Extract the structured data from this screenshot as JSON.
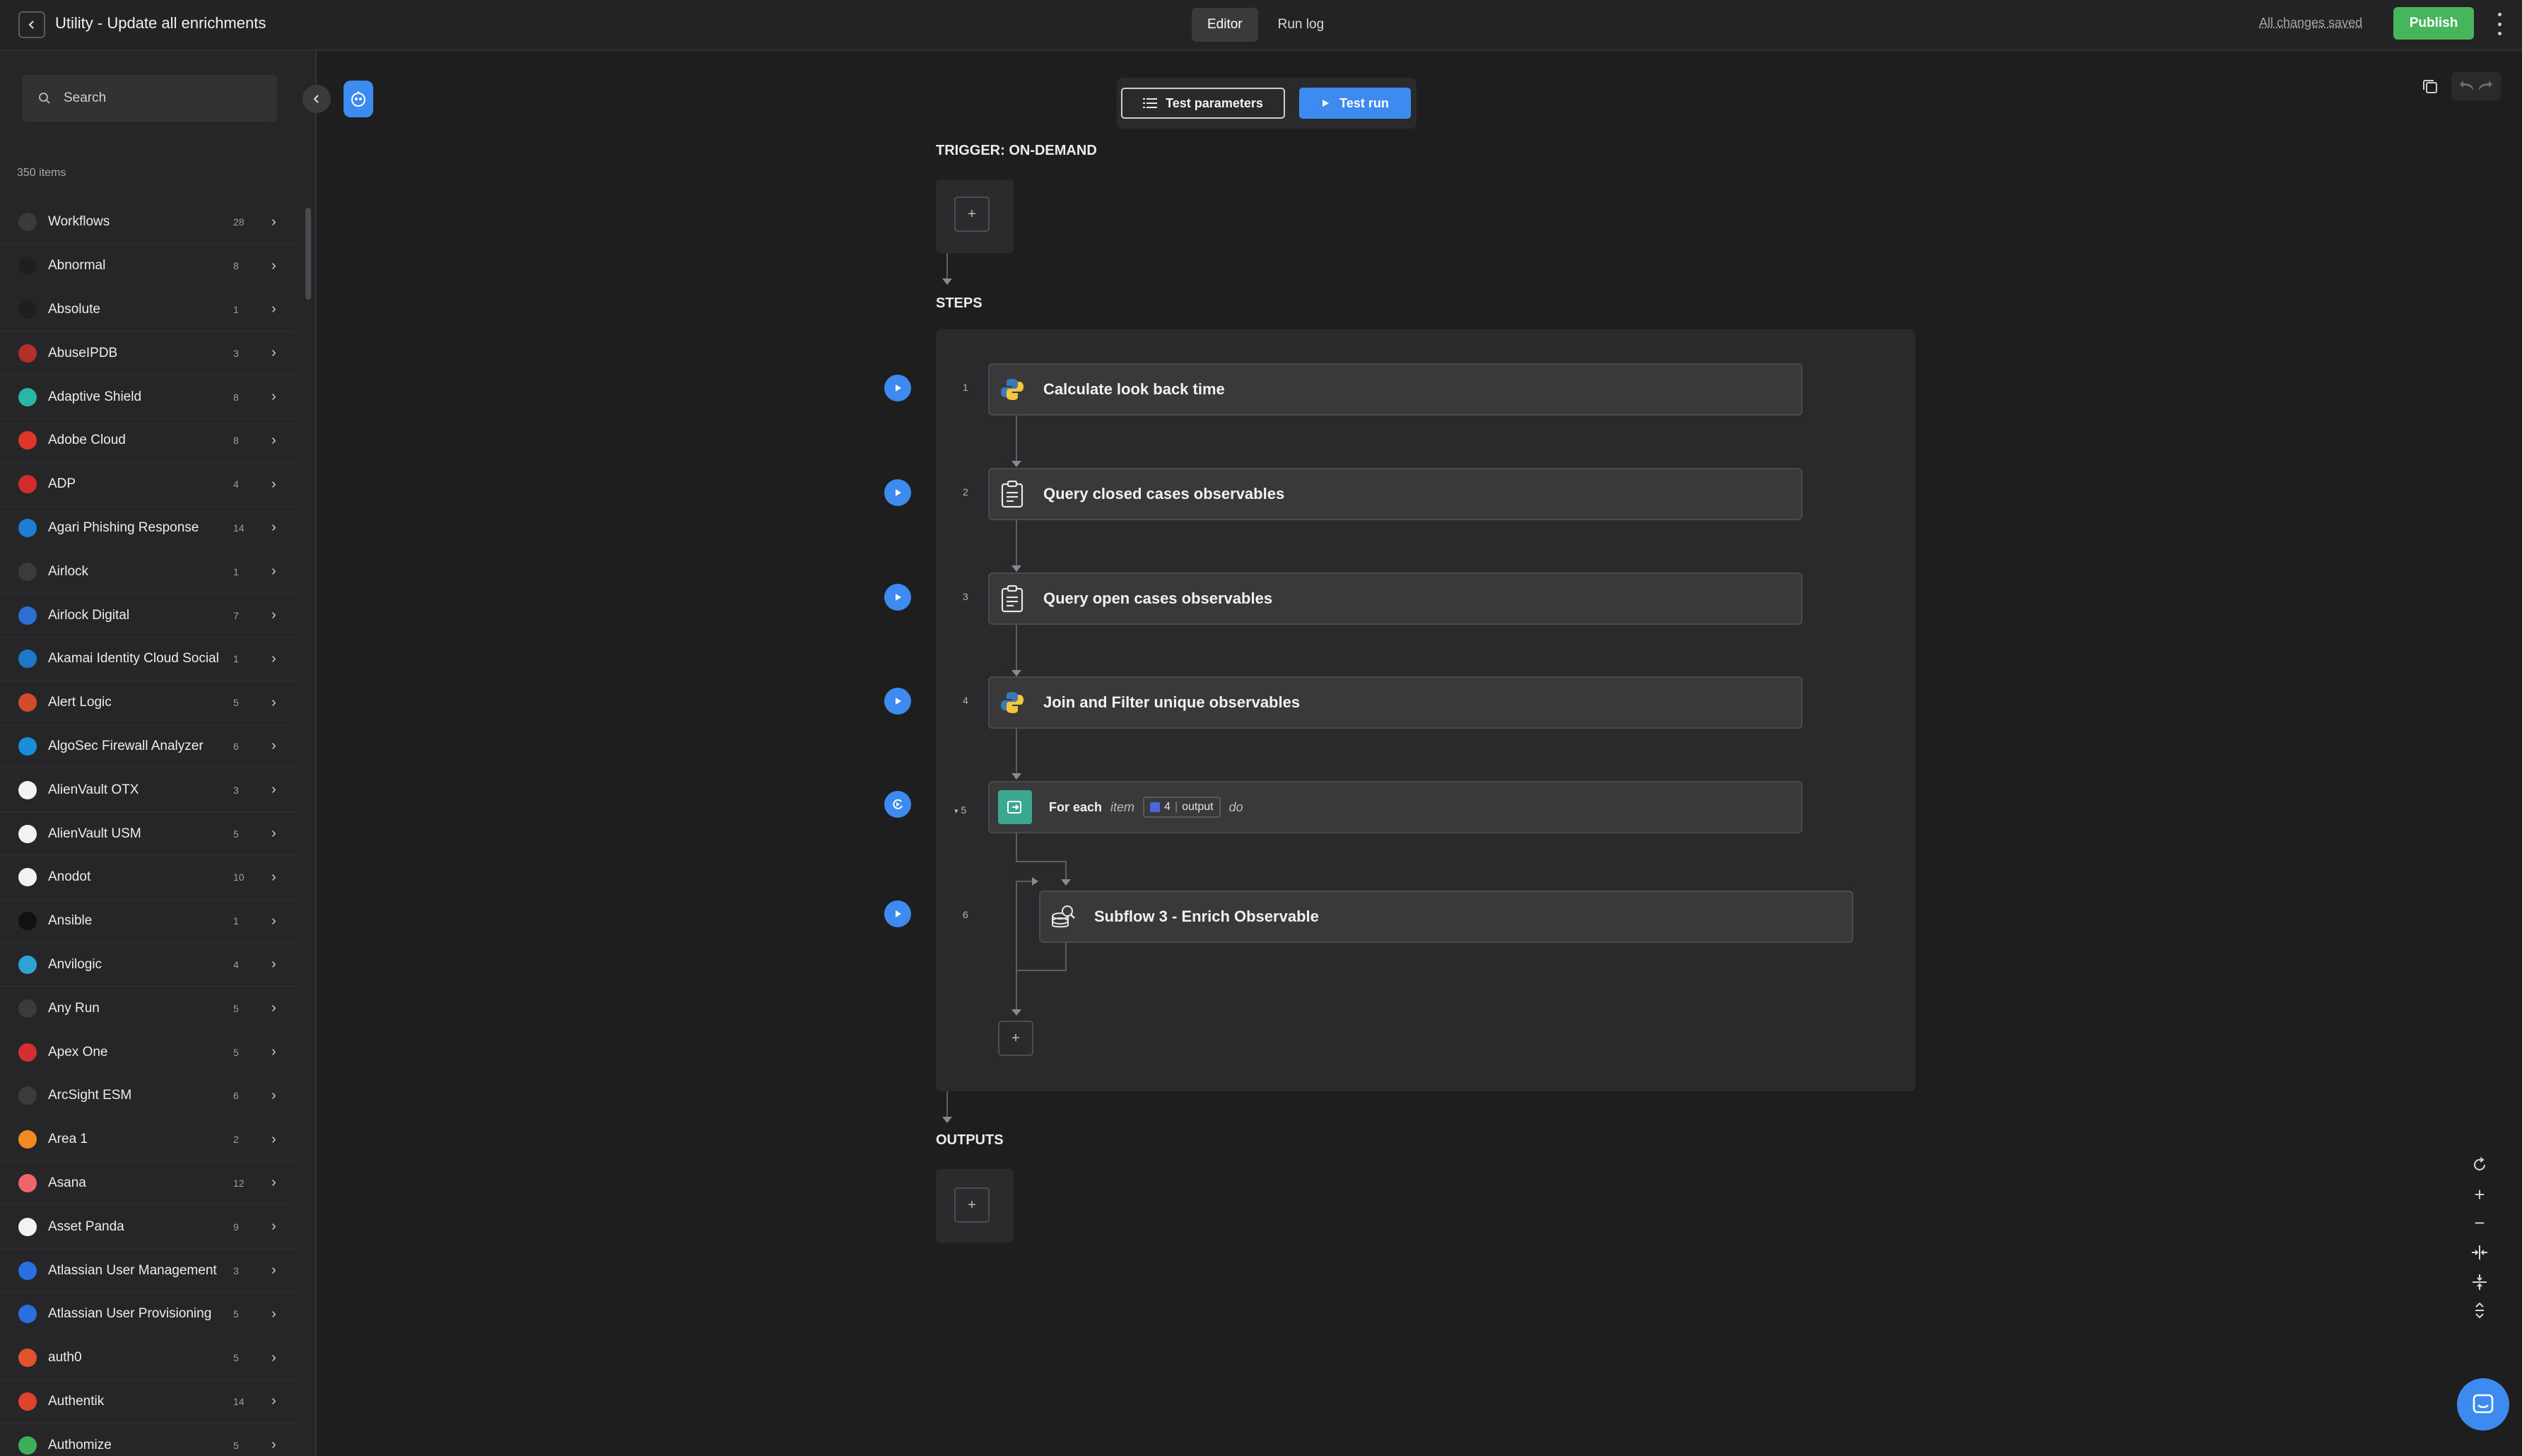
{
  "header": {
    "title": "Utility - Update all enrichments",
    "tabs": [
      {
        "label": "Editor",
        "active": true
      },
      {
        "label": "Run log",
        "active": false
      }
    ],
    "save_status": "All changes saved",
    "publish_label": "Publish"
  },
  "sidebar": {
    "search_placeholder": "Search",
    "item_count": "350 items",
    "items": [
      {
        "label": "Workflows",
        "count": "28",
        "icon": "workflow-icon",
        "color": "#3a3a3d"
      },
      {
        "label": "Abnormal",
        "count": "8",
        "icon": "abnormal-logo-icon",
        "color": "#1f1f21"
      },
      {
        "label": "Absolute",
        "count": "1",
        "icon": "absolute-logo-icon",
        "color": "#1f1f21"
      },
      {
        "label": "AbuseIPDB",
        "count": "3",
        "icon": "abuseipdb-logo-icon",
        "color": "#b1302c"
      },
      {
        "label": "Adaptive Shield",
        "count": "8",
        "icon": "adaptive-shield-logo-icon",
        "color": "#2bb5a6"
      },
      {
        "label": "Adobe Cloud",
        "count": "8",
        "icon": "adobe-logo-icon",
        "color": "#e0352b"
      },
      {
        "label": "ADP",
        "count": "4",
        "icon": "adp-logo-icon",
        "color": "#d22b2b"
      },
      {
        "label": "Agari Phishing Response",
        "count": "14",
        "icon": "agari-logo-icon",
        "color": "#1c7fd1"
      },
      {
        "label": "Airlock",
        "count": "1",
        "icon": "airlock-logo-icon",
        "color": "#3b3b3d"
      },
      {
        "label": "Airlock Digital",
        "count": "7",
        "icon": "airlock-digital-logo-icon",
        "color": "#2a6fd1"
      },
      {
        "label": "Akamai Identity Cloud Social",
        "count": "1",
        "icon": "akamai-logo-icon",
        "color": "#1d78c9"
      },
      {
        "label": "Alert Logic",
        "count": "5",
        "icon": "alert-logic-logo-icon",
        "color": "#d24b2a"
      },
      {
        "label": "AlgoSec Firewall Analyzer",
        "count": "6",
        "icon": "algosec-logo-icon",
        "color": "#1a8fd9"
      },
      {
        "label": "AlienVault OTX",
        "count": "3",
        "icon": "alienvault-logo-icon",
        "color": "#f2f2f2"
      },
      {
        "label": "AlienVault USM",
        "count": "5",
        "icon": "alienvault-logo-icon",
        "color": "#f2f2f2"
      },
      {
        "label": "Anodot",
        "count": "10",
        "icon": "anodot-logo-icon",
        "color": "#f2f2f2"
      },
      {
        "label": "Ansible",
        "count": "1",
        "icon": "ansible-logo-icon",
        "color": "#111112"
      },
      {
        "label": "Anvilogic",
        "count": "4",
        "icon": "anvilogic-logo-icon",
        "color": "#2fa3d6"
      },
      {
        "label": "Any Run",
        "count": "5",
        "icon": "any-run-logo-icon",
        "color": "#3b3b3d"
      },
      {
        "label": "Apex One",
        "count": "5",
        "icon": "apex-one-logo-icon",
        "color": "#d42e2e"
      },
      {
        "label": "ArcSight ESM",
        "count": "6",
        "icon": "arcsight-logo-icon",
        "color": "#3b3b3d"
      },
      {
        "label": "Area 1",
        "count": "2",
        "icon": "area1-logo-icon",
        "color": "#f28a1f"
      },
      {
        "label": "Asana",
        "count": "12",
        "icon": "asana-logo-icon",
        "color": "#f0646b"
      },
      {
        "label": "Asset Panda",
        "count": "9",
        "icon": "asset-panda-logo-icon",
        "color": "#f2f2f2"
      },
      {
        "label": "Atlassian User Management",
        "count": "3",
        "icon": "atlassian-logo-icon",
        "color": "#2a6fe0"
      },
      {
        "label": "Atlassian User Provisioning",
        "count": "5",
        "icon": "atlassian-logo-icon",
        "color": "#2a6fe0"
      },
      {
        "label": "auth0",
        "count": "5",
        "icon": "auth0-logo-icon",
        "color": "#e0532b"
      },
      {
        "label": "Authentik",
        "count": "14",
        "icon": "authentik-logo-icon",
        "color": "#e0432b"
      },
      {
        "label": "Authomize",
        "count": "5",
        "icon": "authomize-logo-icon",
        "color": "#3fae5a"
      }
    ]
  },
  "toolbar": {
    "test_parameters_label": "Test parameters",
    "test_run_label": "Test run"
  },
  "canvas": {
    "trigger_label": "TRIGGER: ON-DEMAND",
    "steps_label": "STEPS",
    "outputs_label": "OUTPUTS",
    "steps": [
      {
        "num": "1",
        "title": "Calculate look back time",
        "icon": "python-icon"
      },
      {
        "num": "2",
        "title": "Query closed cases observables",
        "icon": "query-icon"
      },
      {
        "num": "3",
        "title": "Query open cases observables",
        "icon": "query-icon"
      },
      {
        "num": "4",
        "title": "Join and Filter unique observables",
        "icon": "python-icon"
      },
      {
        "num": "5",
        "title": "For each",
        "icon": "loop-icon",
        "loop_var": "item",
        "chip_ref": "4",
        "chip_field": "output",
        "loop_suffix": "do"
      },
      {
        "num": "6",
        "title": "Subflow 3 - Enrich Observable",
        "icon": "subflow-icon"
      }
    ]
  },
  "colors": {
    "accent": "#3d8bf0",
    "publish": "#46b55c",
    "background": "#1e1e1f"
  }
}
